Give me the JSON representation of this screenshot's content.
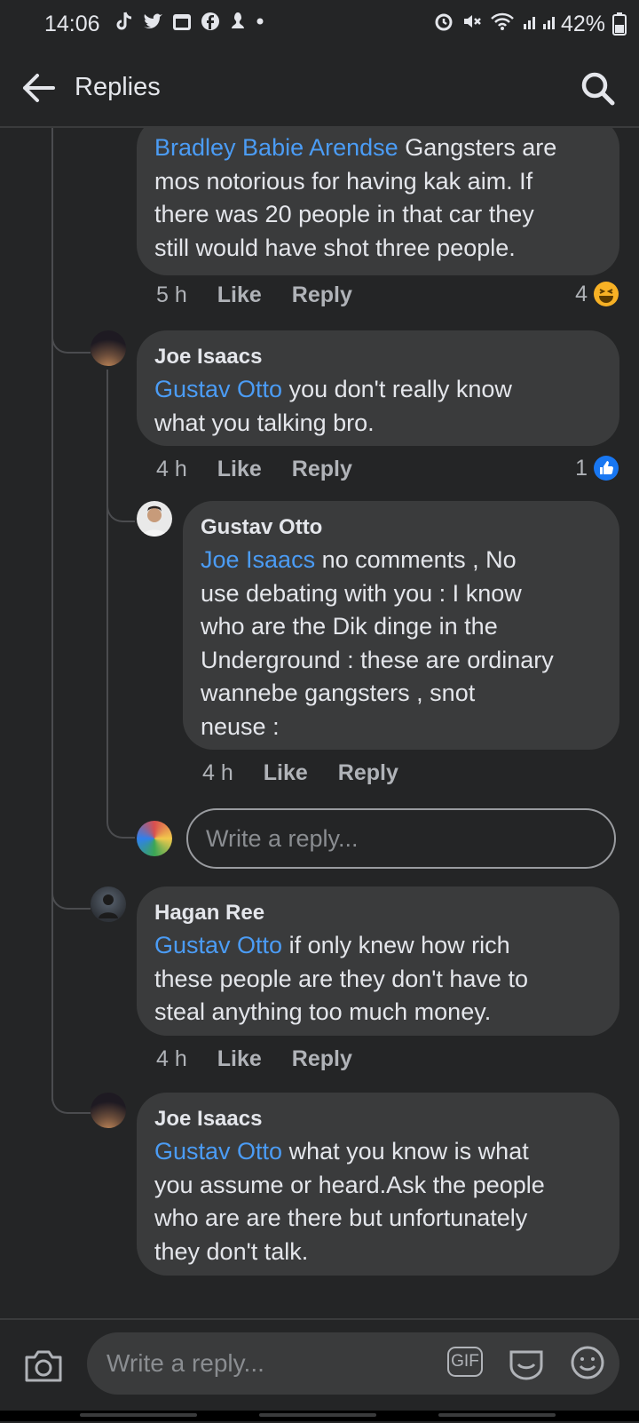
{
  "status_bar": {
    "time": "14:06",
    "battery": "42%",
    "icons_left": [
      "tiktok-icon",
      "twitter-icon",
      "calendar-icon",
      "facebook-icon",
      "notification-icon"
    ],
    "icons_right": [
      "alarm-icon",
      "mute-icon",
      "wifi-icon",
      "signal-icon",
      "battery-icon"
    ]
  },
  "header": {
    "title": "Replies"
  },
  "comments": [
    {
      "author": "",
      "mention": "Bradley Babie Arendse",
      "text_lines": [
        "Gangsters are",
        "mos notorious for having kak aim. If",
        "there was 20 people in that car they",
        "still would have shot three people."
      ],
      "time": "5 h",
      "like": "Like",
      "reply": "Reply",
      "reaction_count": "4",
      "reaction_type": "haha"
    },
    {
      "author": "Joe Isaacs",
      "mention": "Gustav Otto",
      "text_lines": [
        "you don't really know",
        "what you talking bro."
      ],
      "time": "4 h",
      "like": "Like",
      "reply": "Reply",
      "reaction_count": "1",
      "reaction_type": "like"
    },
    {
      "author": "Gustav Otto",
      "mention": "Joe Isaacs",
      "text_lines": [
        "no comments , No",
        "use debating with you : I know",
        "who are the Dik dinge in the",
        "Underground : these are ordinary",
        "wannebe gangsters , snot",
        "neuse :"
      ],
      "time": "4 h",
      "like": "Like",
      "reply": "Reply"
    },
    {
      "author": "Hagan Ree",
      "mention": "Gustav Otto",
      "text_lines": [
        "if only knew how rich",
        "these people are they don't have to",
        "steal anything too much money."
      ],
      "time": "4 h",
      "like": "Like",
      "reply": "Reply"
    },
    {
      "author": "Joe Isaacs",
      "mention": "Gustav Otto",
      "text_lines": [
        "what you know is what",
        "you assume or heard.Ask the people",
        "who are are there but unfortunately",
        "they don't talk."
      ],
      "time": "",
      "like": "",
      "reply": ""
    }
  ],
  "inline_reply": {
    "placeholder": "Write a reply..."
  },
  "composer": {
    "placeholder": "Write a reply...",
    "gif_label": "GIF"
  },
  "colors": {
    "background": "#242526",
    "bubble": "#3a3b3c",
    "mention": "#4b9cf5",
    "like_blue": "#1877f2",
    "haha_yellow": "#f7b125"
  }
}
